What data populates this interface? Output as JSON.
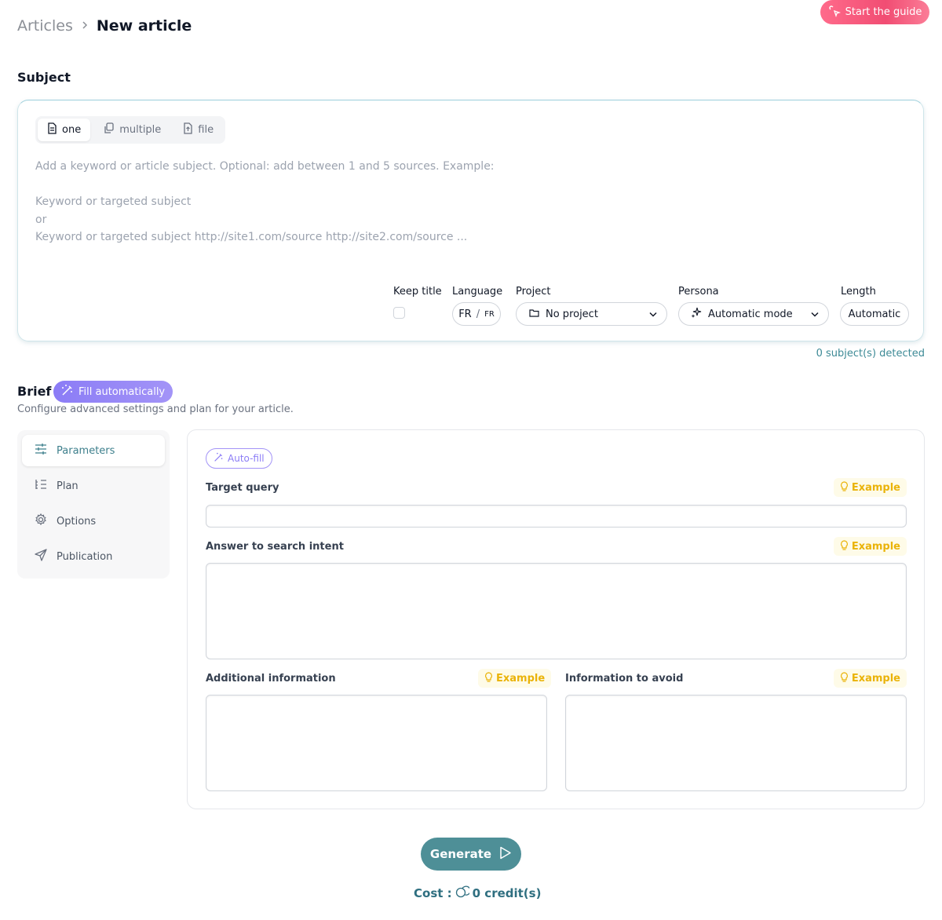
{
  "header": {
    "breadcrumb_parent": "Articles",
    "breadcrumb_sep": ">",
    "breadcrumb_current": "New article",
    "guide_label": "Start the guide"
  },
  "subject": {
    "title": "Subject",
    "tabs": [
      {
        "label": "one",
        "icon": "document-icon",
        "active": true
      },
      {
        "label": "multiple",
        "icon": "copy-icon",
        "active": false
      },
      {
        "label": "file",
        "icon": "file-upload-icon",
        "active": false
      }
    ],
    "placeholder": "Add a keyword or article subject. Optional: add between 1 and 5 sources. Example:\n\nKeyword or targeted subject\nor\nKeyword or targeted subject http://site1.com/source http://site2.com/source ...",
    "keep_title_label": "Keep title",
    "language_label": "Language",
    "language_from": "FR",
    "language_slash": "/",
    "language_to": "FR",
    "project_label": "Project",
    "project_value": "No project",
    "persona_label": "Persona",
    "persona_value": "Automatic mode",
    "length_label": "Length",
    "length_value": "Automatic",
    "detected": "0 subject(s) detected"
  },
  "brief": {
    "title": "Brief",
    "fill_auto_label": "Fill automatically",
    "description": "Configure advanced settings and plan for your article.",
    "nav": [
      {
        "label": "Parameters",
        "icon": "sliders-icon",
        "active": true
      },
      {
        "label": "Plan",
        "icon": "list-icon",
        "active": false
      },
      {
        "label": "Options",
        "icon": "gear-icon",
        "active": false
      },
      {
        "label": "Publication",
        "icon": "send-icon",
        "active": false
      }
    ],
    "autofill_label": "Auto-fill",
    "example_label": "Example",
    "target_query_label": "Target query",
    "search_intent_label": "Answer to search intent",
    "additional_info_label": "Additional information",
    "info_avoid_label": "Information to avoid"
  },
  "footer": {
    "generate_label": "Generate",
    "cost_label": "Cost :",
    "cost_value": "0 credit(s)"
  },
  "colors": {
    "accent": "#4e8f97",
    "guide": "#f14d73",
    "brief_purple": "#8b7cf6",
    "example_yellow": "#eab308"
  }
}
